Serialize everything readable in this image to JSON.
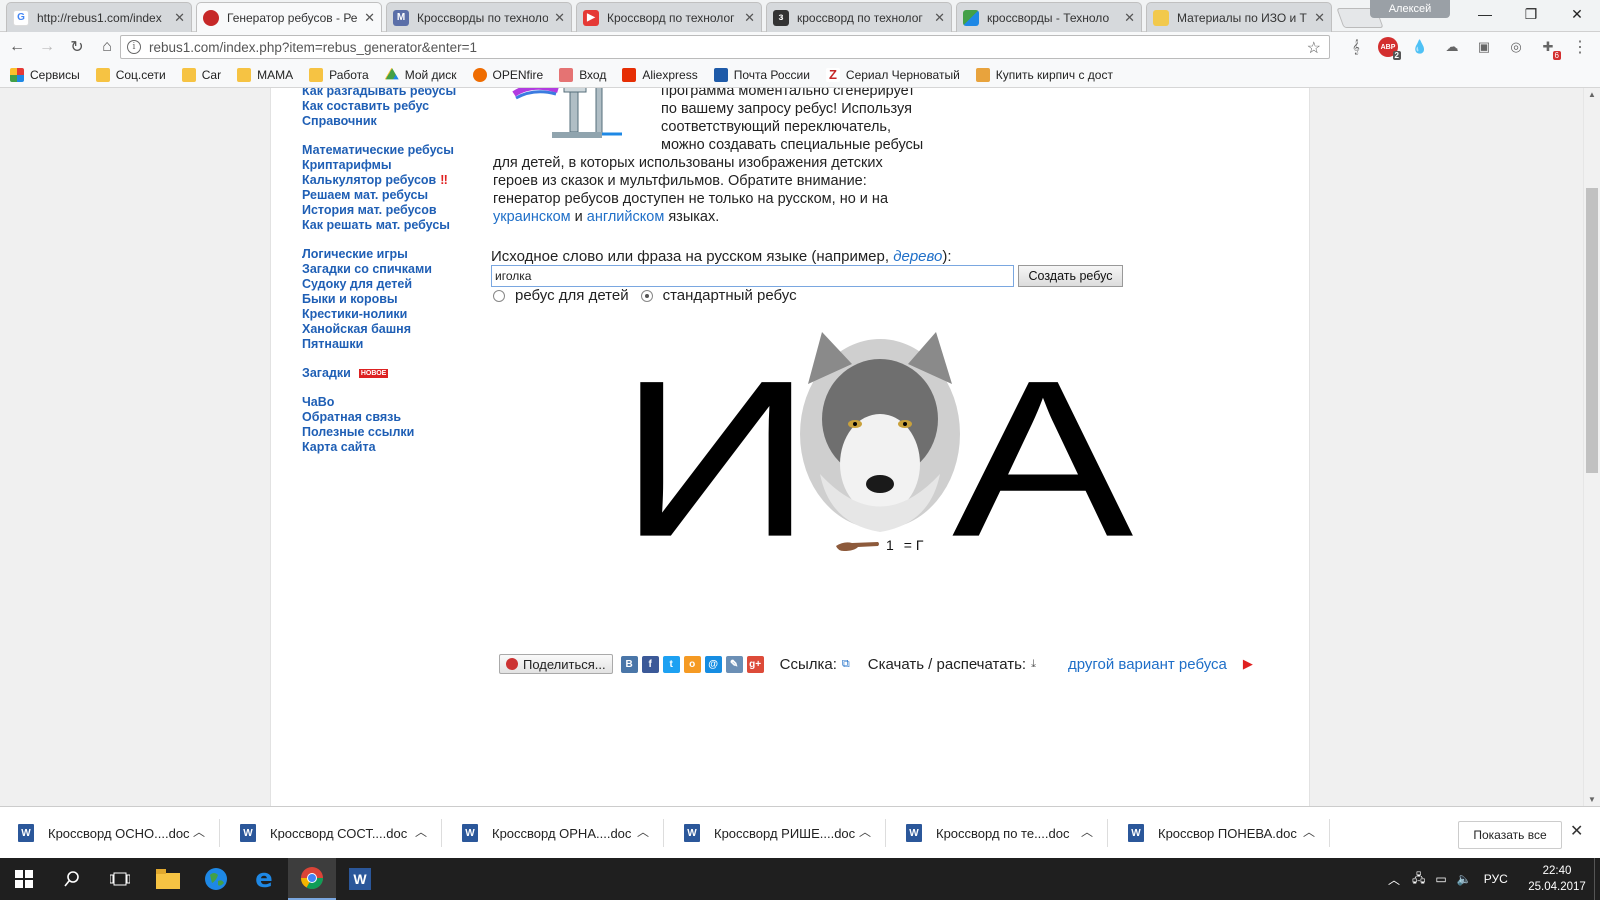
{
  "tabs": [
    {
      "title": "http://rebus1.com/index",
      "icon": "google-g-icon",
      "color": "#ffffff"
    },
    {
      "title": "Генератор ребусов - Ре",
      "icon": "red-ball-icon",
      "color": "#c62828"
    },
    {
      "title": "Кроссворды по техноло",
      "icon": "m-icon",
      "color": "#5b6fa8"
    },
    {
      "title": "Кроссворд по технолог",
      "icon": "play-icon",
      "color": "#e53935"
    },
    {
      "title": "кроссворд по технолог",
      "icon": "z-icon",
      "color": "#333333"
    },
    {
      "title": "кроссворды - Техноло",
      "icon": "green-triangle-icon",
      "color": "#43a047"
    },
    {
      "title": "Материалы по ИЗО и Т",
      "icon": "pencil-icon",
      "color": "#f2c94c"
    }
  ],
  "profile_name": "Алексей",
  "url": "rebus1.com/index.php?item=rebus_generator&enter=1",
  "extensions": [
    {
      "icon": "clef-icon"
    },
    {
      "icon": "adblock-icon",
      "badge": "2"
    },
    {
      "icon": "drop-icon"
    },
    {
      "icon": "cloud-icon"
    },
    {
      "icon": "box-icon"
    },
    {
      "icon": "globe-icon"
    },
    {
      "icon": "puzzle-icon",
      "badge": "6"
    },
    {
      "icon": "menu-icon"
    }
  ],
  "bookmarks": [
    {
      "label": "Сервисы",
      "icon": "apps-icon"
    },
    {
      "label": "Соц.сети",
      "icon": "folder-icon"
    },
    {
      "label": "Car",
      "icon": "folder-icon"
    },
    {
      "label": "МАМА",
      "icon": "folder-icon"
    },
    {
      "label": "Работа",
      "icon": "folder-icon"
    },
    {
      "label": "Мой диск",
      "icon": "drive-icon"
    },
    {
      "label": "OPENfire",
      "icon": "fire-icon"
    },
    {
      "label": "Вход",
      "icon": "mail-icon"
    },
    {
      "label": "Aliexpress",
      "icon": "aliexpress-icon"
    },
    {
      "label": "Почта России",
      "icon": "eagle-icon"
    },
    {
      "label": "Сериал Черноватый",
      "icon": "z-icon"
    },
    {
      "label": "Купить кирпич с дост",
      "icon": "brick-icon"
    }
  ],
  "sidenav": {
    "group1": [
      "Как разгадывать ребусы",
      "Как составить ребус",
      "Справочник"
    ],
    "group2": [
      "Математические ребусы",
      "Криптарифмы",
      "Калькулятор ребусов",
      "Решаем мат. ребусы",
      "История мат. ребусов",
      "Как решать мат. ребусы"
    ],
    "calc_mark": "‼",
    "group3": [
      "Логические игры",
      "Загадки со спичками",
      "Судоку для детей",
      "Быки и коровы",
      "Крестики-нолики",
      "Ханойская башня",
      "Пятнашки"
    ],
    "riddles": "Загадки",
    "riddles_badge": "НОВОЕ",
    "group4": [
      "ЧаВо",
      "Обратная связь",
      "Полезные ссылки",
      "Карта сайта"
    ]
  },
  "description": {
    "l1": "программа моментально сгенерирует",
    "l2": "по вашему запросу ребус! Используя",
    "l3": "соответствующий переключатель,",
    "l4": "можно создавать специальные ребусы",
    "l5": "для детей, в которых использованы изображения детских",
    "l6": "героев из сказок и мультфильмов. Обратите внимание:",
    "l7": "генератор ребусов доступен не только на русском, но и на",
    "link1": "украинском",
    "and": "и",
    "link2": "английском",
    "tail": "языках."
  },
  "form": {
    "label_before": "Исходное слово или фраза на русском языке (например,",
    "example": "дерево",
    "label_after": "):",
    "input_value": "иголка",
    "submit": "Создать ребус",
    "radio_kids": "ребус для детей",
    "radio_standard": "стандартный ребус",
    "selected": "standard"
  },
  "rebus": {
    "letter1": "И",
    "picture": "wolf-head",
    "letter2": "А",
    "hint_number": "1",
    "hint_rule": "= Г"
  },
  "share": {
    "button": "Поделиться...",
    "networks": [
      {
        "icon": "vk-icon",
        "glyph": "В",
        "color": "#4a76a8"
      },
      {
        "icon": "facebook-icon",
        "glyph": "f",
        "color": "#3b5998"
      },
      {
        "icon": "twitter-icon",
        "glyph": "t",
        "color": "#1da1f2"
      },
      {
        "icon": "odnoklassniki-icon",
        "glyph": "о",
        "color": "#f59a23"
      },
      {
        "icon": "mailru-icon",
        "glyph": "@",
        "color": "#168de2"
      },
      {
        "icon": "livejournal-icon",
        "glyph": "✎",
        "color": "#6b8fb5"
      },
      {
        "icon": "googleplus-icon",
        "glyph": "g+",
        "color": "#dd4b39"
      }
    ],
    "link_label": "Ссылка:",
    "download_label": "Скачать / распечатать:",
    "other_variant": "другой вариант ребуса"
  },
  "downloads": [
    "Кроссворд ОСНО....doc",
    "Кроссворд СОСТ....doc",
    "Кроссворд ОРНА....doc",
    "Кроссворд РИШЕ....doc",
    "Кроссворд по те....doc",
    "Кроссвор ПОНЕВА.doc"
  ],
  "show_all": "Показать все",
  "taskbar": {
    "lang": "РУС",
    "time": "22:40",
    "date": "25.04.2017"
  }
}
